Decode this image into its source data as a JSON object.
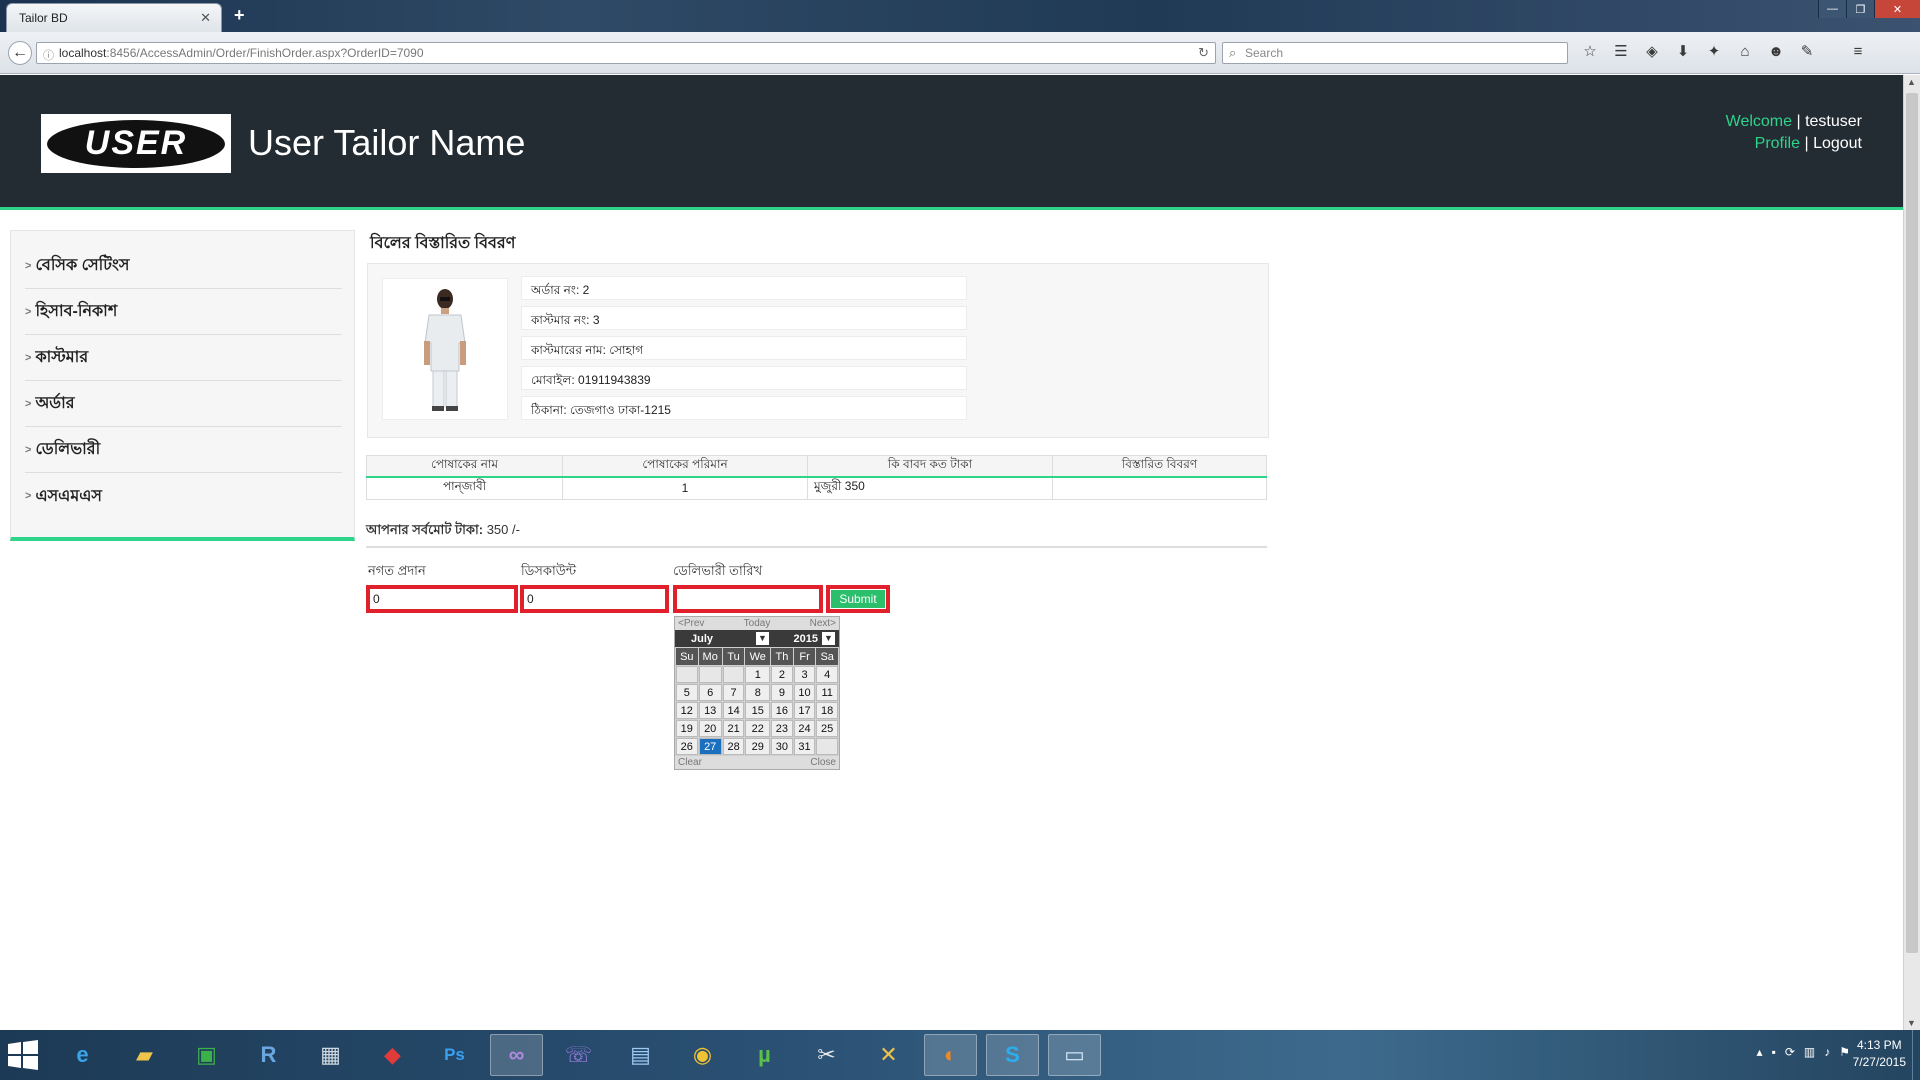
{
  "browser": {
    "tab_title": "Tailor BD",
    "url_host": "localhost",
    "url_rest": ":8456/AccessAdmin/Order/FinishOrder.aspx?OrderID=7090",
    "search_placeholder": "Search"
  },
  "header": {
    "logo_text": "USER",
    "site_title": "User Tailor Name",
    "welcome_label": "Welcome",
    "username": "testuser",
    "profile_label": "Profile",
    "logout_label": "Logout"
  },
  "sidebar": {
    "items": [
      {
        "label": "বেসিক সেটিংস"
      },
      {
        "label": "হিসাব-নিকাশ"
      },
      {
        "label": "কাস্টমার"
      },
      {
        "label": "অর্ডার"
      },
      {
        "label": "ডেলিভারী"
      },
      {
        "label": "এসএমএস"
      }
    ]
  },
  "bill": {
    "title": "বিলের বিস্তারিত বিবরণ",
    "order_no": "অর্ডার নং: 2",
    "customer_no": "কাস্টমার নং: 3",
    "customer_name": "কাস্টমারের নাম: সোহাগ",
    "mobile": "মোবাইল: 01911943839",
    "address": "ঠিকানা: তেজগাও ঢাকা-1215"
  },
  "table": {
    "headers": [
      "পোষাকের নাম",
      "পোষাকের পরিমান",
      "কি বাবদ কত টাকা",
      "বিস্তারিত বিবরণ"
    ],
    "rows": [
      {
        "name": "পান্জাবী",
        "qty": "1",
        "charge": "মুজুরী 350",
        "details": ""
      }
    ]
  },
  "total": {
    "label": "আপনার সর্বমোট টাকা:",
    "amount": "350 /-"
  },
  "form": {
    "cash_label": "নগত প্রদান",
    "cash_value": "0",
    "discount_label": "ডিসকাউন্ট",
    "discount_value": "0",
    "delivery_label": "ডেলিভারী তারিখ",
    "delivery_value": "",
    "submit_label": "Submit"
  },
  "calendar": {
    "prev": "<Prev",
    "today": "Today",
    "next": "Next>",
    "month": "July",
    "year": "2015",
    "weekdays": [
      "Su",
      "Mo",
      "Tu",
      "We",
      "Th",
      "Fr",
      "Sa"
    ],
    "weeks": [
      [
        "",
        "",
        "",
        "1",
        "2",
        "3",
        "4"
      ],
      [
        "5",
        "6",
        "7",
        "8",
        "9",
        "10",
        "11"
      ],
      [
        "12",
        "13",
        "14",
        "15",
        "16",
        "17",
        "18"
      ],
      [
        "19",
        "20",
        "21",
        "22",
        "23",
        "24",
        "25"
      ],
      [
        "26",
        "27",
        "28",
        "29",
        "30",
        "31",
        ""
      ]
    ],
    "selected_day": "27",
    "clear": "Clear",
    "close": "Close"
  },
  "taskbar": {
    "time": "4:13 PM",
    "date": "7/27/2015",
    "apps": [
      "internet-explorer",
      "file-explorer",
      "store",
      "r-app",
      "calculator",
      "red-app",
      "photoshop",
      "visual-studio",
      "viber",
      "network-app",
      "chrome",
      "utorrent",
      "paint-app",
      "tools-app",
      "firefox",
      "skype",
      "remote-desktop"
    ]
  },
  "colors": {
    "accent": "#2ed48a",
    "header_bg": "#232b33",
    "highlight_red": "#e0202a",
    "submit_green": "#2bbf6c",
    "calendar_today": "#1a6fbf"
  }
}
